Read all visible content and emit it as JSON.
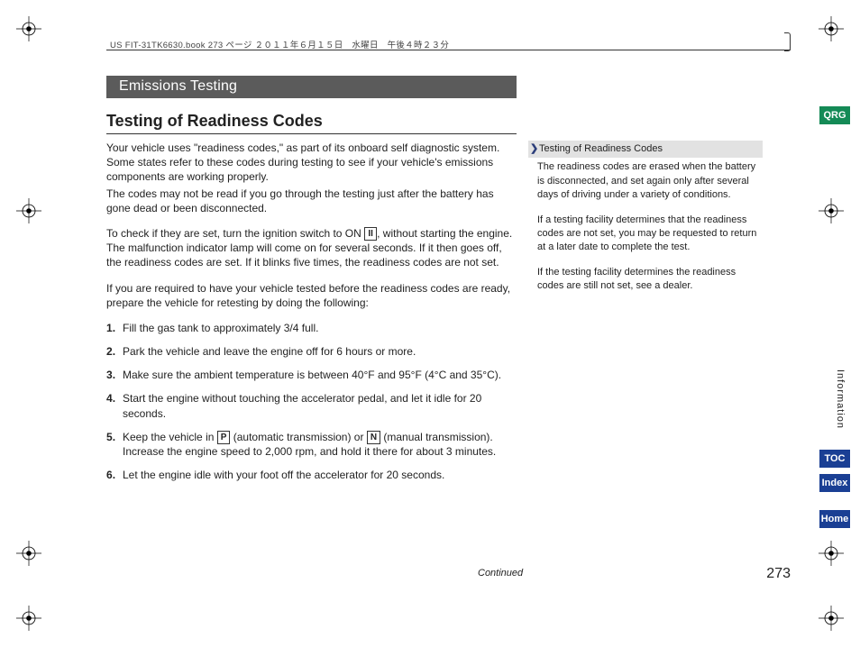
{
  "crumb": "US FIT-31TK6630.book  273 ページ  ２０１１年６月１５日　水曜日　午後４時２３分",
  "chapter": "Emissions Testing",
  "section": "Testing of Readiness Codes",
  "paras": {
    "p1a": "Your vehicle uses \"readiness codes,\" as part of its onboard self diagnostic system. Some states refer to these codes during testing to see if your vehicle's emissions components are working properly.",
    "p1b": "The codes may not be read if you go through the testing just after the battery has gone dead or been disconnected.",
    "p2a": "To check if they are set, turn the ignition switch to ON ",
    "p2b": ", without starting the engine. The malfunction indicator lamp will come on for several seconds. If it then goes off, the readiness codes are set. If it blinks five times, the readiness codes are not set.",
    "p3": "If you are required to have your vehicle tested before the readiness codes are ready, prepare the vehicle for retesting by doing the following:"
  },
  "steps": {
    "s1": "Fill the gas tank to approximately 3/4 full.",
    "s2": "Park the vehicle and leave the engine off for 6 hours or more.",
    "s3": "Make sure the ambient temperature is between 40°F and 95°F (4°C and 35°C).",
    "s4": "Start the engine without touching the accelerator pedal, and let it idle for 20 seconds.",
    "s5a": "Keep the vehicle in ",
    "s5b": " (automatic transmission) or ",
    "s5c": " (manual transmission). Increase the engine speed to 2,000 rpm, and hold it there for about 3 minutes.",
    "s6": "Let the engine idle with your foot off the accelerator for 20 seconds."
  },
  "keycaps": {
    "on": "II",
    "p": "P",
    "n": "N"
  },
  "side": {
    "title": "Testing of Readiness Codes",
    "p1": "The readiness codes are erased when the battery is disconnected, and set again only after several days of driving under a variety of conditions.",
    "p2": "If a testing facility determines that the readiness codes are not set, you may be requested to return at a later date to complete the test.",
    "p3": "If the testing facility determines the readiness codes are still not set, see a dealer."
  },
  "continued": "Continued",
  "pageNumber": "273",
  "tabs": {
    "qrg": "QRG",
    "toc": "TOC",
    "index": "Index",
    "home": "Home"
  },
  "vertical": "Information"
}
